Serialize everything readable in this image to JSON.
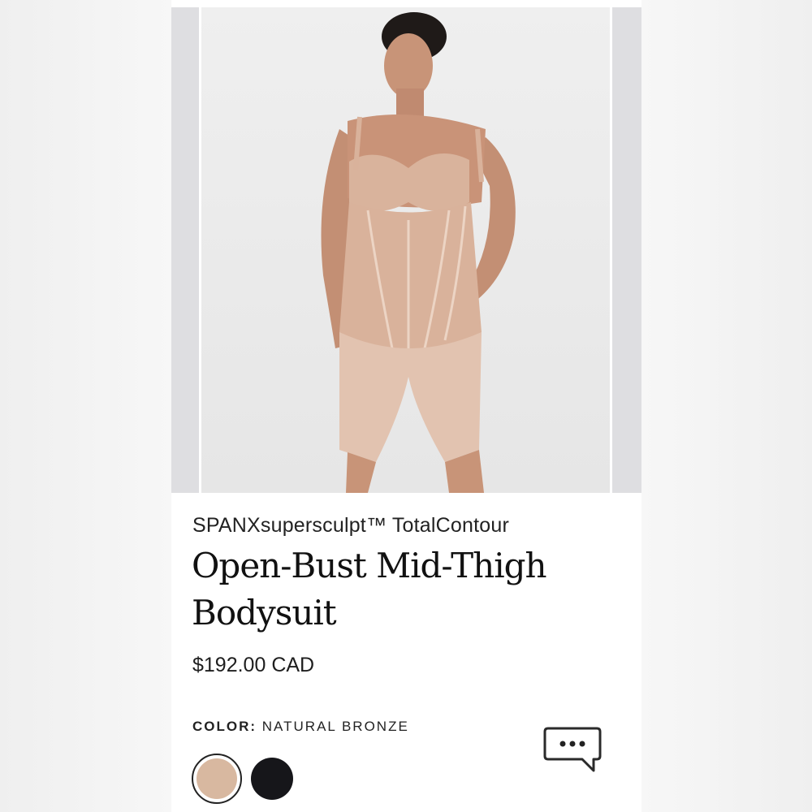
{
  "product": {
    "brand": "SPANXsupersculpt™ TotalContour",
    "title": "Open-Bust Mid-Thigh Bodysuit",
    "price": "$192.00 CAD",
    "color_label": "COLOR:",
    "color_value": "NATURAL BRONZE"
  },
  "swatches": [
    {
      "name": "natural-bronze",
      "color": "#d8b8a0",
      "selected": true
    },
    {
      "name": "black",
      "color": "#16161a",
      "selected": false
    }
  ],
  "colors": {
    "background": "#f3f3f3",
    "card": "#ffffff",
    "gallery_edge": "#dedee1",
    "text": "#111111"
  },
  "icons": {
    "chat": "chat-bubble-icon"
  }
}
